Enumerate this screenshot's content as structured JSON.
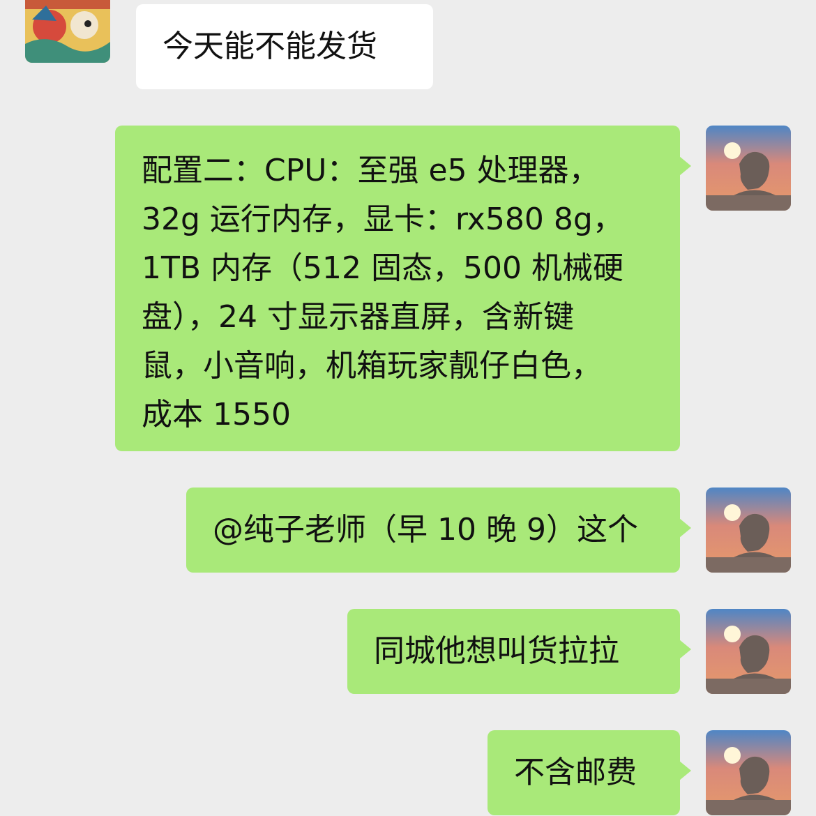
{
  "messages": [
    {
      "id": "m1",
      "side": "in",
      "avatar": "sender-avatar",
      "text": "今天能不能发货"
    },
    {
      "id": "m2",
      "side": "out",
      "avatar": "self-avatar",
      "lines": [
        "配置二：CPU：至强 e5 处理器，",
        "32g 运行内存，显卡：rx580 8g，",
        "1TB 内存（512 固态，500 机械硬",
        "盘），24 寸显示器直屏，含新键",
        "鼠，小音响，机箱玩家靓仔白色，",
        "成本 1550"
      ]
    },
    {
      "id": "m3",
      "side": "out",
      "avatar": "self-avatar",
      "text": "@纯子老师（早 10 晚 9）这个"
    },
    {
      "id": "m4",
      "side": "out",
      "avatar": "self-avatar",
      "text": "同城他想叫货拉拉"
    },
    {
      "id": "m5",
      "side": "out",
      "avatar": "self-avatar",
      "text": "不含邮费"
    }
  ],
  "colors": {
    "background": "#ededed",
    "incoming_bubble": "#ffffff",
    "outgoing_bubble": "#a9e979"
  }
}
